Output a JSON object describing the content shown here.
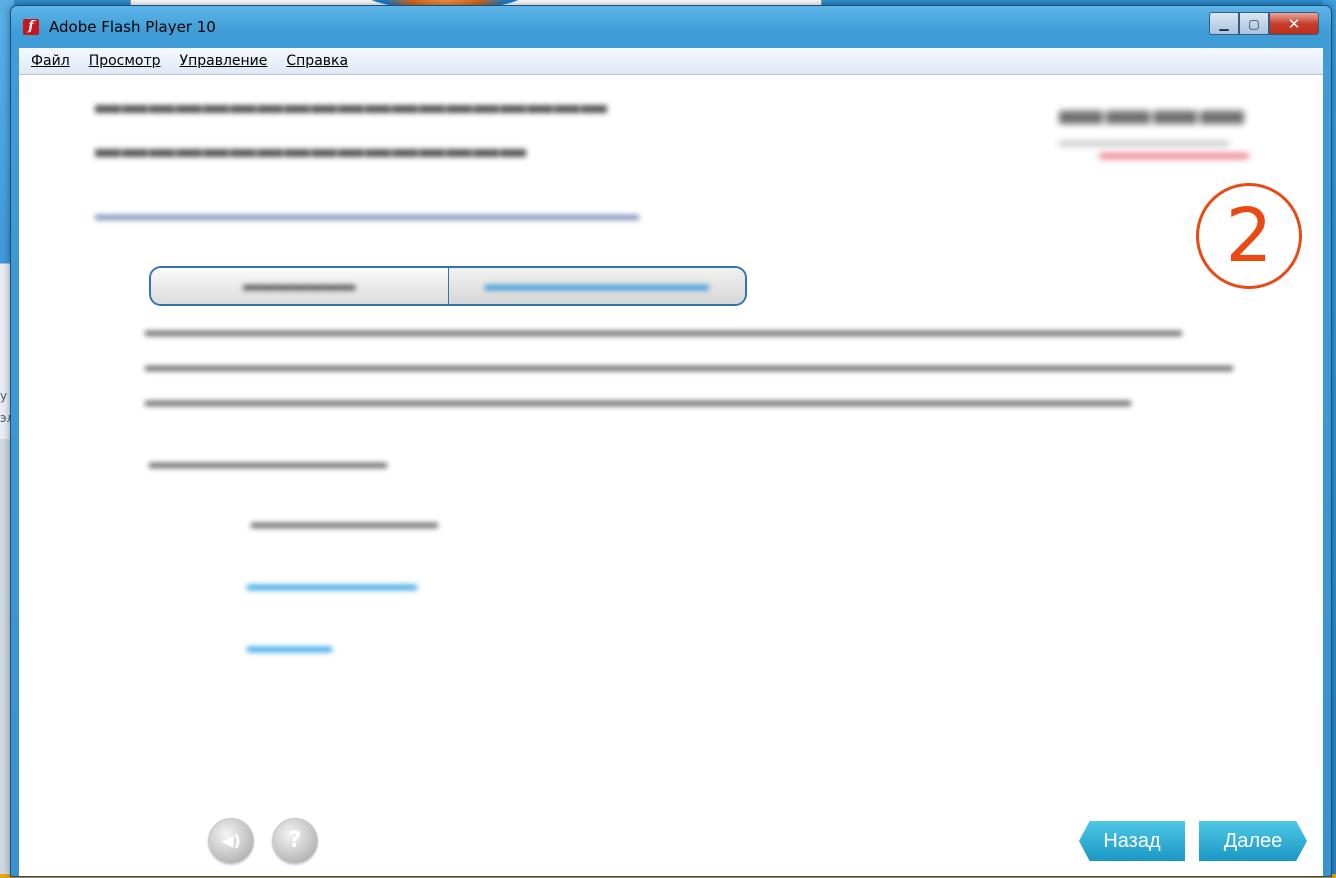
{
  "background": {
    "left_text": "у с\nэл"
  },
  "window": {
    "title": "Adobe Flash Player 10",
    "app_icon": "flash-icon",
    "buttons": {
      "minimize": "minimize-icon",
      "maximize": "maximize-icon",
      "close": "close-icon"
    }
  },
  "menu": {
    "items": [
      {
        "label": "Файл"
      },
      {
        "label": "Просмотр"
      },
      {
        "label": "Управление"
      },
      {
        "label": "Справка"
      }
    ]
  },
  "content": {
    "step_number": "2",
    "colors": {
      "step_circle": "#ea4a12",
      "link": "#2ea3e3",
      "nav_button": "#1a97c4",
      "tab_border": "#2e74b6"
    }
  },
  "nav": {
    "back_label": "Назад",
    "next_label": "Далее",
    "sound_icon": "speaker-icon",
    "help_icon": "question-icon"
  }
}
